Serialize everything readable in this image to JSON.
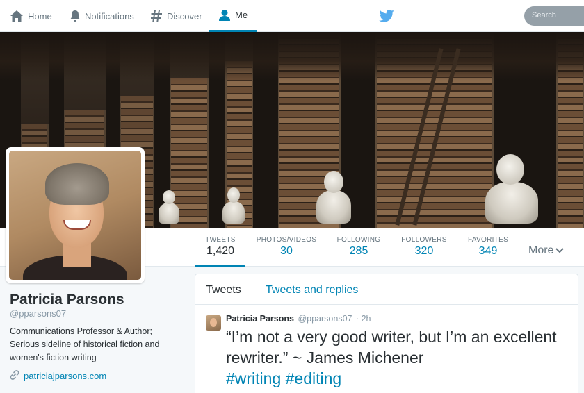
{
  "nav": {
    "items": [
      {
        "label": "Home",
        "icon": "home-icon"
      },
      {
        "label": "Notifications",
        "icon": "bell-icon"
      },
      {
        "label": "Discover",
        "icon": "hashtag-icon"
      },
      {
        "label": "Me",
        "icon": "person-icon",
        "active": true
      }
    ],
    "search_placeholder": "Search",
    "accent_color": "#0084b4",
    "logo_color": "#55acee"
  },
  "profile": {
    "name": "Patricia Parsons",
    "handle": "@pparsons07",
    "bio": "Communications Professor & Author; Serious sideline of historical fiction and women's fiction writing",
    "website": "patriciajparsons.com"
  },
  "stats": [
    {
      "label": "TWEETS",
      "value": "1,420",
      "active": true
    },
    {
      "label": "PHOTOS/VIDEOS",
      "value": "30"
    },
    {
      "label": "FOLLOWING",
      "value": "285"
    },
    {
      "label": "FOLLOWERS",
      "value": "320"
    },
    {
      "label": "FAVORITES",
      "value": "349"
    }
  ],
  "more_label": "More",
  "timeline": {
    "tabs": [
      "Tweets",
      "Tweets and replies"
    ],
    "tweet": {
      "name": "Patricia Parsons",
      "handle": "@pparsons07",
      "time": "· 2h",
      "text": "“I’m not a very good writer, but I’m an excellent rewriter.” ~ James  Michener",
      "hashtags": "#writing #editing"
    }
  }
}
